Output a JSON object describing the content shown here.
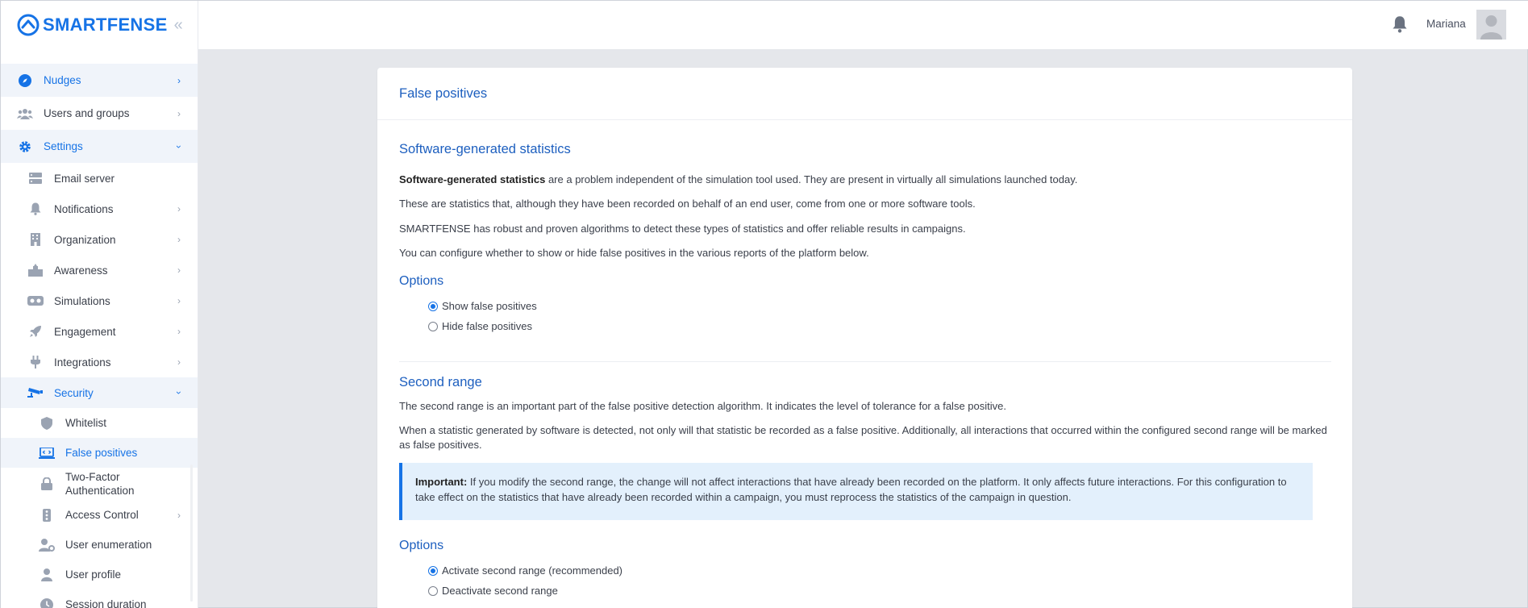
{
  "brand": {
    "name": "SMARTFENSE",
    "color": "#1673e6"
  },
  "topbar": {
    "username": "Mariana"
  },
  "sidebar": {
    "items": [
      {
        "label": "Nudges",
        "icon": "compass-icon"
      },
      {
        "label": "Users and groups",
        "icon": "users-icon"
      },
      {
        "label": "Settings",
        "icon": "gear-icon"
      }
    ],
    "settings_items": [
      {
        "label": "Email server",
        "icon": "server-icon"
      },
      {
        "label": "Notifications",
        "icon": "bell-icon"
      },
      {
        "label": "Organization",
        "icon": "building-icon"
      },
      {
        "label": "Awareness",
        "icon": "awareness-icon"
      },
      {
        "label": "Simulations",
        "icon": "vr-goggles-icon"
      },
      {
        "label": "Engagement",
        "icon": "rocket-icon"
      },
      {
        "label": "Integrations",
        "icon": "plug-icon"
      },
      {
        "label": "Security",
        "icon": "cctv-icon"
      }
    ],
    "security_items": [
      {
        "label": "Whitelist",
        "icon": "shield-icon"
      },
      {
        "label": "False positives",
        "icon": "laptop-code-icon"
      },
      {
        "label": "Two-Factor Authentication",
        "icon": "lock-icon"
      },
      {
        "label": "Access Control",
        "icon": "traffic-light-icon"
      },
      {
        "label": "User enumeration",
        "icon": "user-gear-icon"
      },
      {
        "label": "User profile",
        "icon": "user-icon"
      },
      {
        "label": "Session duration",
        "icon": "clock-icon"
      }
    ]
  },
  "page": {
    "title": "False positives",
    "section1": {
      "heading": "Software-generated statistics",
      "p1_bold": "Software-generated statistics",
      "p1_rest": " are a problem independent of the simulation tool used. They are present in virtually all simulations launched today.",
      "p2": "These are statistics that, although they have been recorded on behalf of an end user, come from one or more software tools.",
      "p3": "SMARTFENSE has robust and proven algorithms to detect these types of statistics and offer reliable results in campaigns.",
      "p4": "You can configure whether to show or hide false positives in the various reports of the platform below.",
      "options_heading": "Options",
      "option_show": "Show false positives",
      "option_hide": "Hide false positives"
    },
    "section2": {
      "heading": "Second range",
      "p1": "The second range is an important part of the false positive detection algorithm. It indicates the level of tolerance for a false positive.",
      "p2": "When a statistic generated by software is detected, not only will that statistic be recorded as a false positive. Additionally, all interactions that occurred within the configured second range will be marked as false positives.",
      "alert_bold": "Important:",
      "alert_text": " If you modify the second range, the change will not affect interactions that have already been recorded on the platform. It only affects future interactions. For this configuration to take effect on the statistics that have already been recorded within a campaign, you must reprocess the statistics of the campaign in question.",
      "options_heading": "Options",
      "option_activate": "Activate second range (recommended)",
      "option_deactivate": "Deactivate second range"
    }
  }
}
